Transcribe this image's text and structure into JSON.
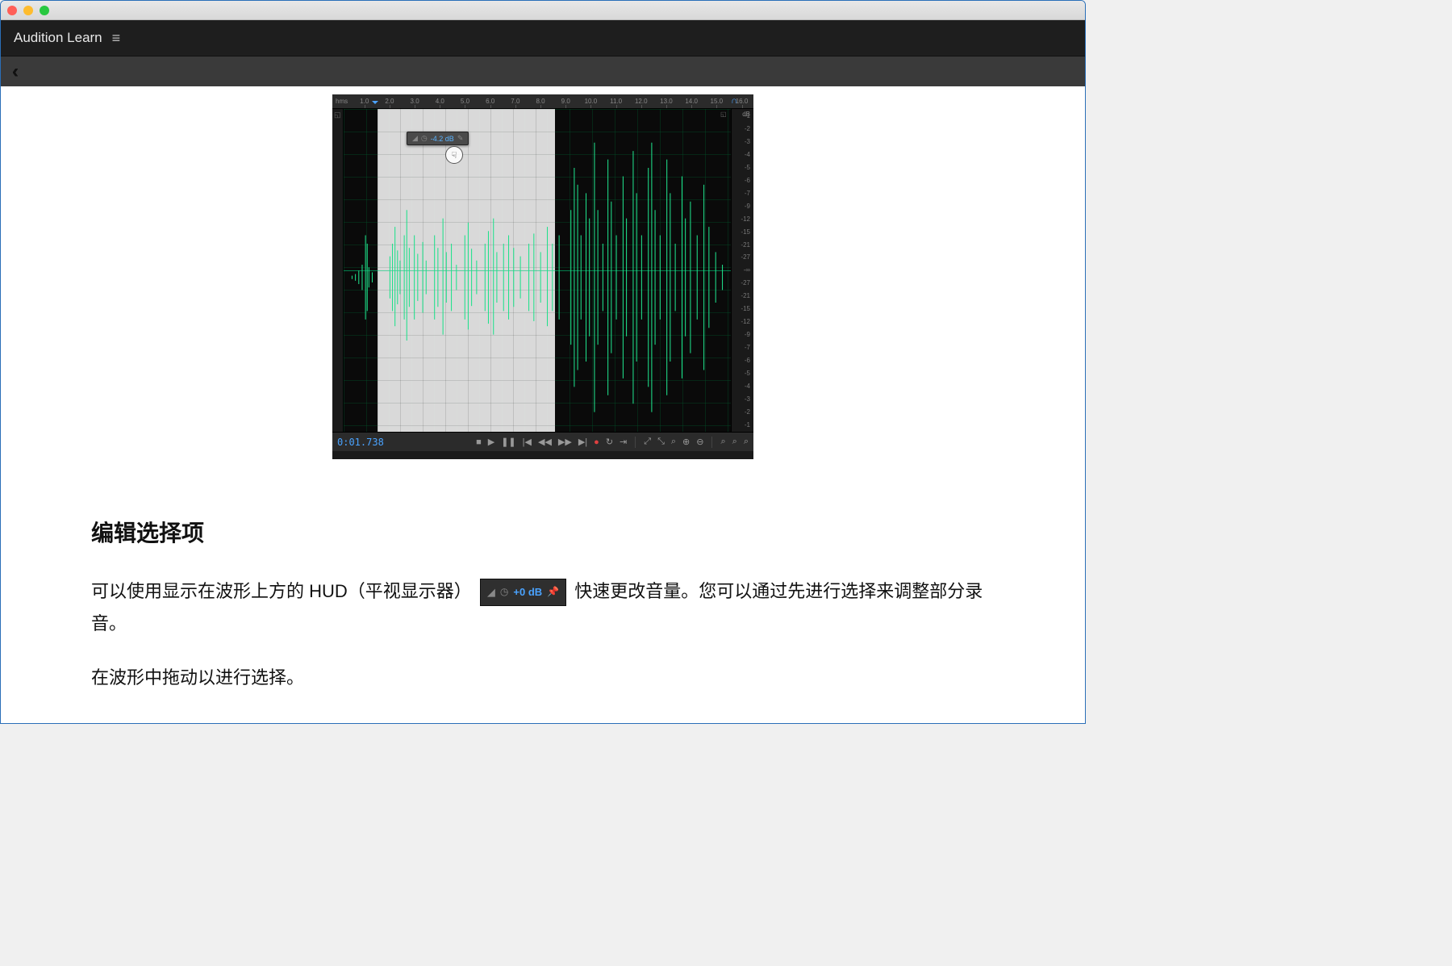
{
  "app": {
    "title": "Audition Learn"
  },
  "ruler": {
    "unit": "hms",
    "ticks": [
      "1.0",
      "2.0",
      "3.0",
      "4.0",
      "5.0",
      "6.0",
      "7.0",
      "8.0",
      "9.0",
      "10.0",
      "11.0",
      "12.0",
      "13.0",
      "14.0",
      "15.0",
      "16.0"
    ]
  },
  "hud": {
    "value": "-4.2 dB"
  },
  "db_scale": {
    "label": "dB",
    "upper": [
      "-1",
      "-2",
      "-3",
      "-4",
      "-5",
      "-6",
      "-7",
      "-9",
      "-12",
      "-15",
      "-21",
      "-27",
      "-∞"
    ],
    "lower": [
      "-27",
      "-21",
      "-15",
      "-12",
      "-9",
      "-7",
      "-6",
      "-5",
      "-4",
      "-3",
      "-2",
      "-1"
    ]
  },
  "transport": {
    "timecode": "0:01.738"
  },
  "inline_hud": {
    "value": "+0 dB"
  },
  "article": {
    "heading": "编辑选择项",
    "p1a": "可以使用显示在波形上方的 HUD（平视显示器）",
    "p1b": "快速更改音量。您可以通过先进行选择来调整部分录音。",
    "p2": "在波形中拖动以进行选择。"
  }
}
